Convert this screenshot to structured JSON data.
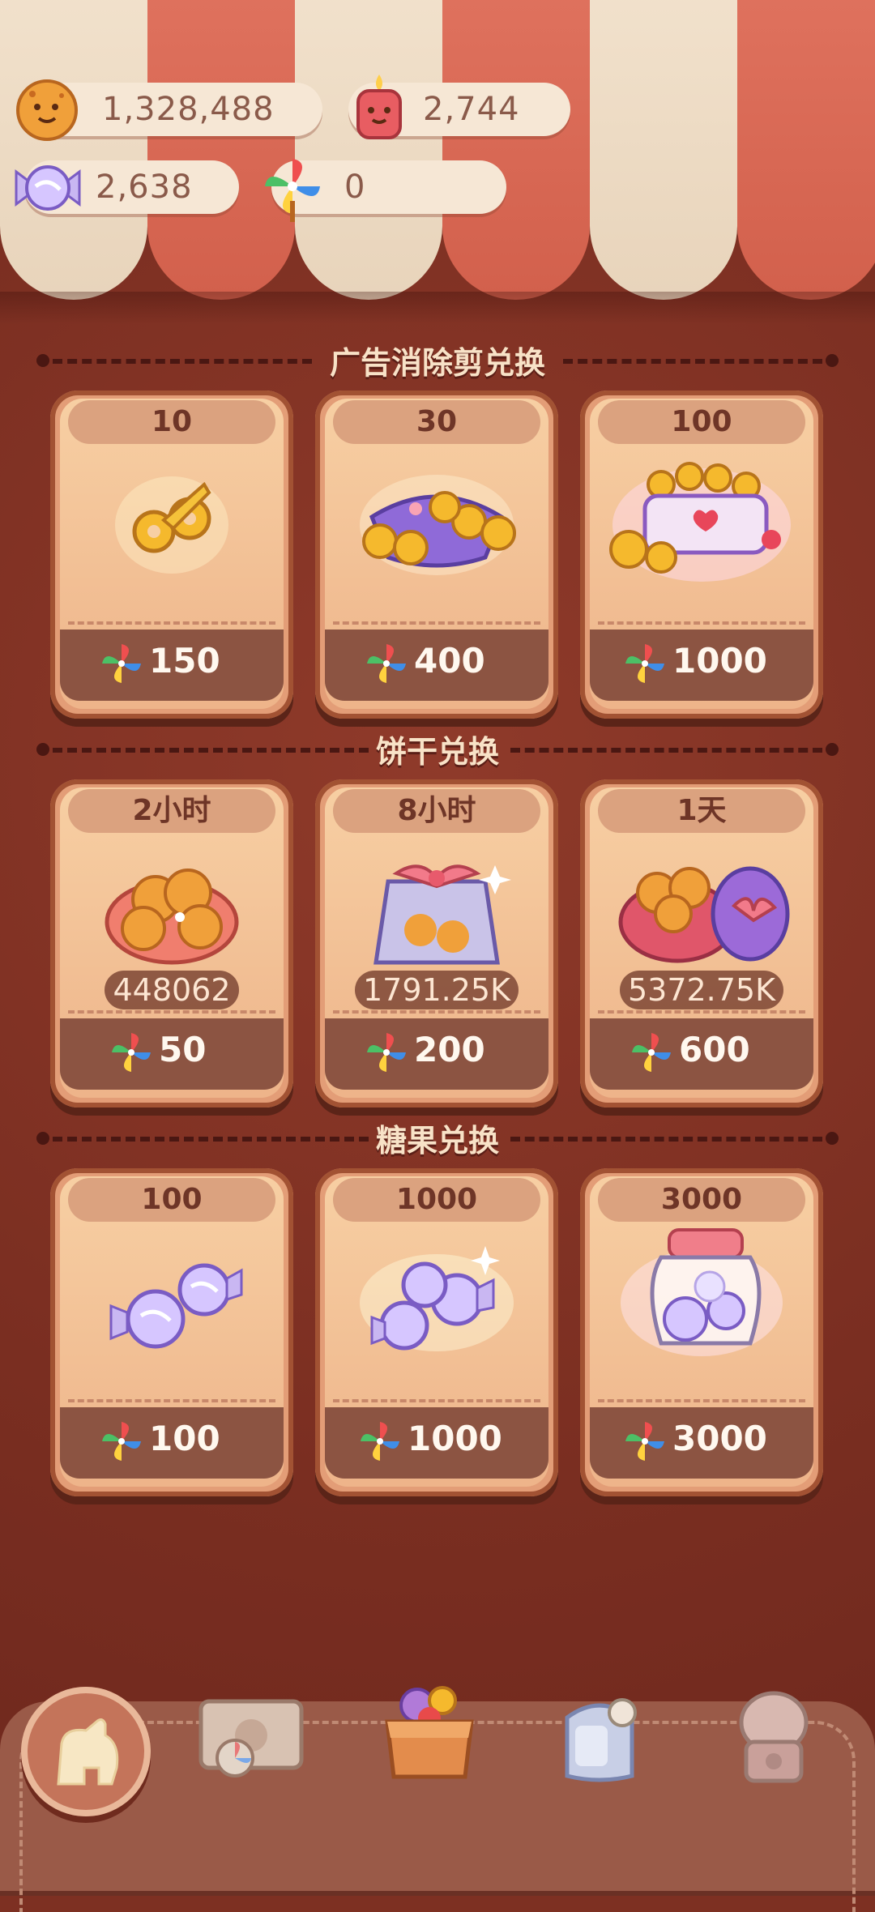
{
  "currencies": {
    "cookies": "1,328,488",
    "candles": "2,744",
    "candy": "2,638",
    "pinwheel": "0"
  },
  "sections": [
    {
      "title": "广告消除剪兑换",
      "items": [
        {
          "label": "10",
          "price": "150",
          "icon": "gold-scissors-icon"
        },
        {
          "label": "30",
          "price": "400",
          "icon": "scissors-basket-icon"
        },
        {
          "label": "100",
          "price": "1000",
          "icon": "scissors-jar-icon"
        }
      ]
    },
    {
      "title": "饼干兑换",
      "items": [
        {
          "label": "2小时",
          "amount": "448062",
          "price": "50",
          "icon": "cookie-pile-icon"
        },
        {
          "label": "8小时",
          "amount": "1791.25K",
          "price": "200",
          "icon": "cookie-gift-bag-icon"
        },
        {
          "label": "1天",
          "amount": "5372.75K",
          "price": "600",
          "icon": "cookie-gift-box-icon"
        }
      ]
    },
    {
      "title": "糖果兑换",
      "items": [
        {
          "label": "100",
          "price": "100",
          "icon": "two-candies-icon"
        },
        {
          "label": "1000",
          "price": "1000",
          "icon": "candy-pile-icon"
        },
        {
          "label": "3000",
          "price": "3000",
          "icon": "candy-jar-icon"
        }
      ]
    }
  ],
  "nav": {
    "items": [
      "back-icon",
      "map-icon",
      "shop-box-icon",
      "wardrobe-icon",
      "machine-icon"
    ]
  },
  "colors": {
    "background": "#7d3022",
    "card": "#f7cfa3",
    "price_band": "#8c5442",
    "awning_red": "#e0735f",
    "awning_cream": "#f2e2cd"
  }
}
